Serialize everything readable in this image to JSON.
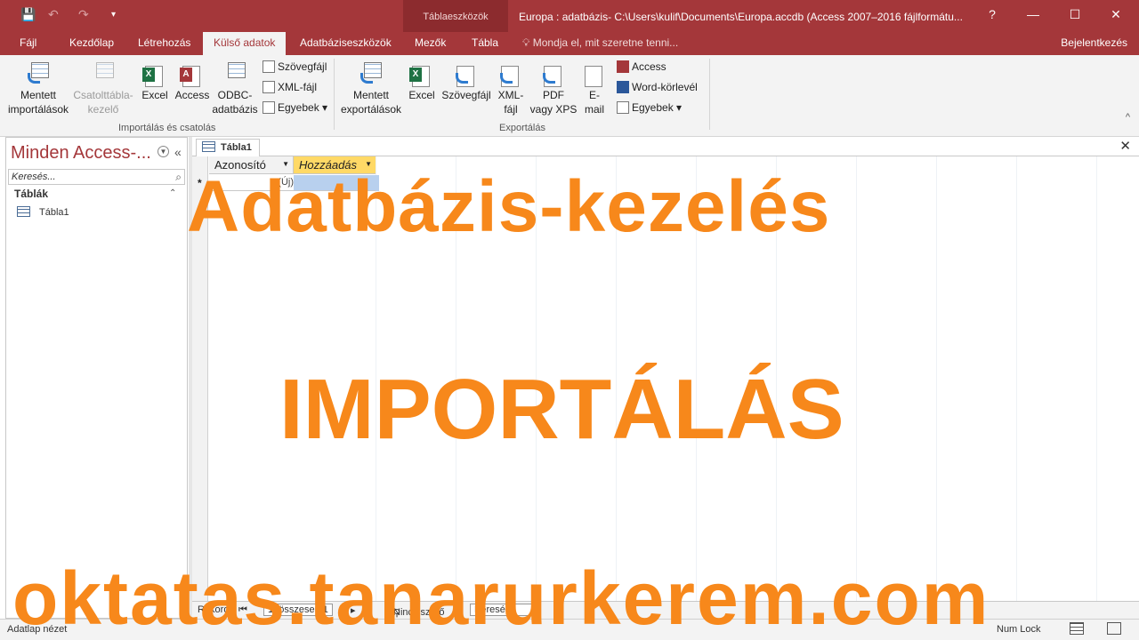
{
  "window": {
    "title": "Europa : adatbázis- C:\\Users\\kulif\\Documents\\Europa.accdb (Access 2007–2016 fájlformátu...",
    "context_label": "Táblaeszközök",
    "help": "?",
    "minimize": "—",
    "maximize": "☐",
    "close": "✕"
  },
  "quick_access": {
    "save": "💾",
    "undo": "↶",
    "redo": "↷",
    "customize": "▾"
  },
  "tabs": [
    {
      "label": "Fájl"
    },
    {
      "label": "Kezdőlap"
    },
    {
      "label": "Létrehozás"
    },
    {
      "label": "Külső adatok"
    },
    {
      "label": "Adatbáziseszközök"
    },
    {
      "label": "Mezők"
    },
    {
      "label": "Tábla"
    }
  ],
  "tell_me": "Mondja el, mit szeretne tenni...",
  "sign_in": "Bejelentkezés",
  "ribbon": {
    "import_group": {
      "label": "Importálás és csatolás",
      "saved_imports": [
        "Mentett",
        "importálások"
      ],
      "linked_table_manager": [
        "Csatolttábla-",
        "kezelő"
      ],
      "excel": "Excel",
      "access": "Access",
      "odbc": [
        "ODBC-",
        "adatbázis"
      ],
      "text_file": "Szövegfájl",
      "xml_file": "XML-fájl",
      "more": "Egyebek"
    },
    "export_group": {
      "label": "Exportálás",
      "saved_exports": [
        "Mentett",
        "exportálások"
      ],
      "excel": "Excel",
      "text_file": "Szövegfájl",
      "xml_file": [
        "XML-",
        "fájl"
      ],
      "pdf": [
        "PDF",
        "vagy XPS"
      ],
      "email": [
        "E-",
        "mail"
      ],
      "access": "Access",
      "word_merge": "Word-körlevél",
      "more": "Egyebek"
    }
  },
  "nav": {
    "title": "Minden Access-...",
    "search_placeholder": "Keresés...",
    "group": "Táblák",
    "items": [
      "Tábla1"
    ]
  },
  "document": {
    "tab": "Tábla1",
    "columns": [
      "Azonosító",
      "Hozzáadás"
    ],
    "new_row_marker": "*",
    "new_value": "(Új)"
  },
  "record_nav": {
    "label": "Rekord:",
    "position": "1, összesen 1",
    "filter": "Nincs szűrő",
    "search": "Keresés"
  },
  "status": {
    "left": "Adatlap nézet",
    "right": "Num Lock"
  },
  "overlay": {
    "line1": "Adatbázis-kezelés",
    "line2": "IMPORTÁLÁS",
    "line3": "oktatas.tanarurkerem.com"
  }
}
